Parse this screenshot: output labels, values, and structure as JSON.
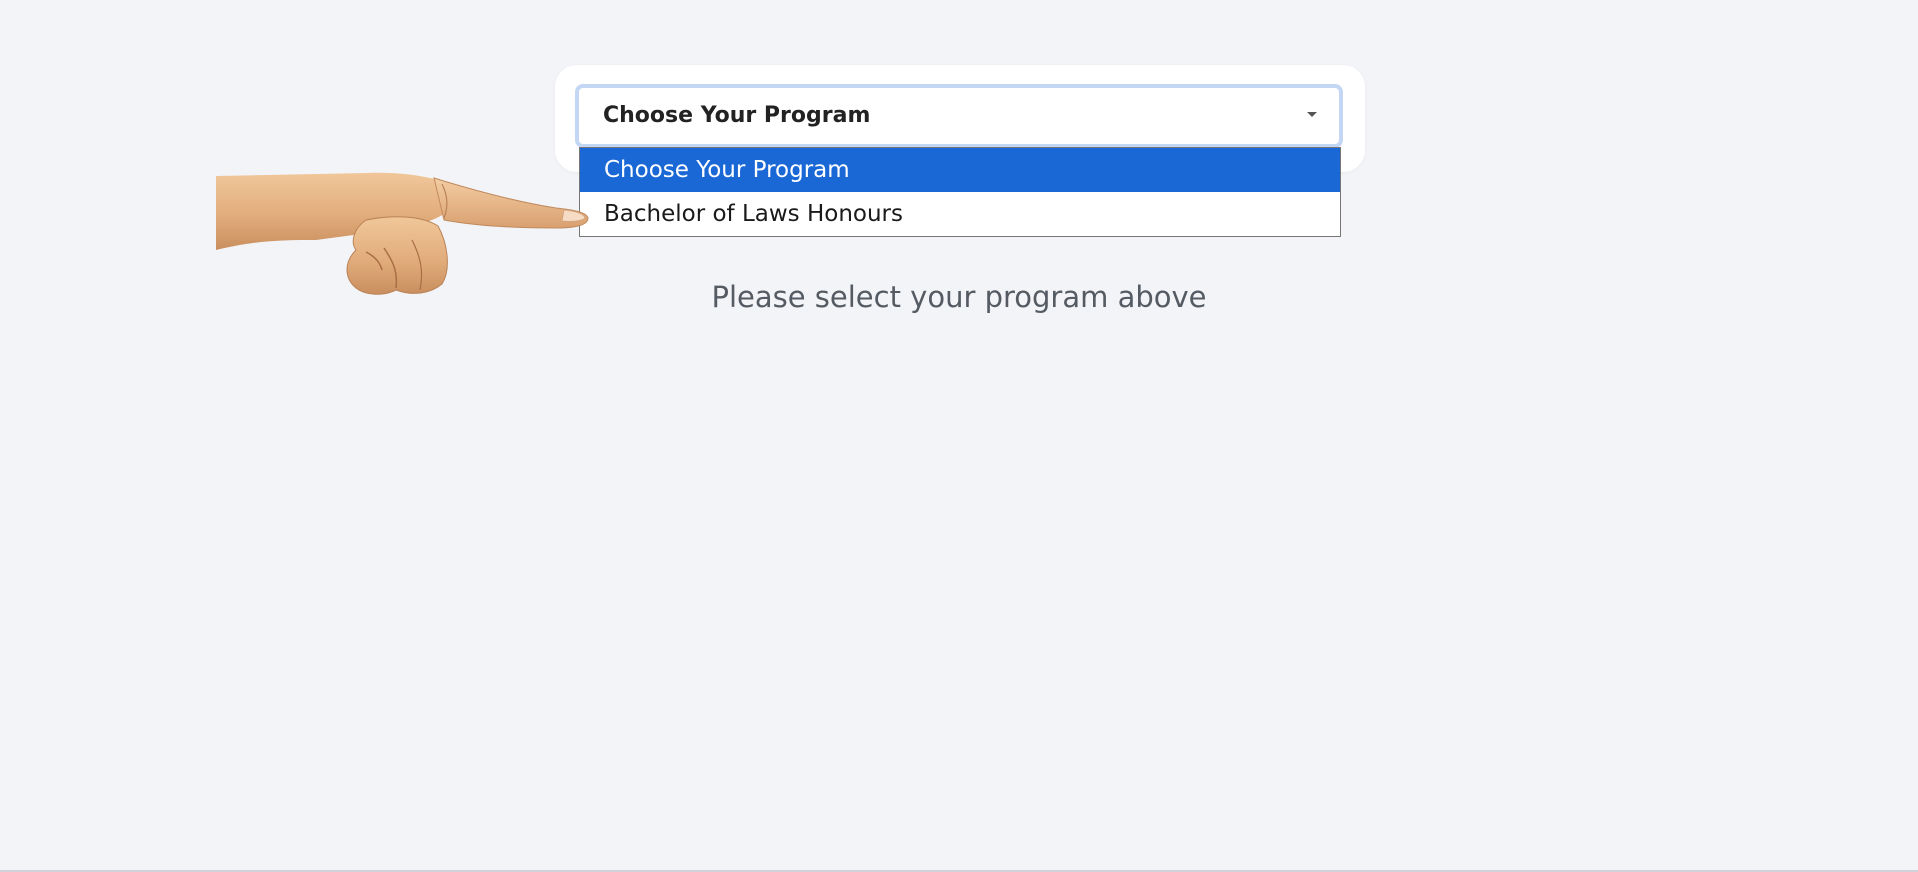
{
  "program_select": {
    "value": "Choose Your Program",
    "options": [
      {
        "label": "Choose Your Program",
        "selected": true
      },
      {
        "label": "Bachelor of Laws Honours",
        "selected": false
      }
    ],
    "highlight_color": "#1a68d6"
  },
  "hint_text": "Please select your program above",
  "pointer_icon": "pointing-hand-icon"
}
